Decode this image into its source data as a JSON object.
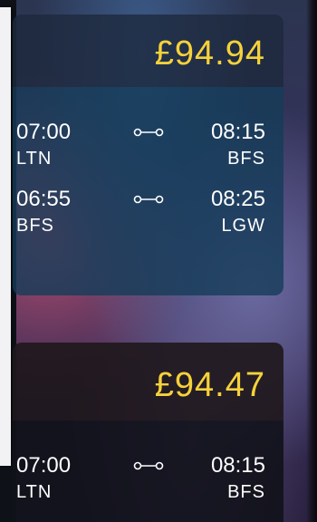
{
  "offers": [
    {
      "price": "£94.94",
      "flights": [
        {
          "dep_time": "07:00",
          "dep_code": "LTN",
          "arr_time": "08:15",
          "arr_code": "BFS"
        },
        {
          "dep_time": "06:55",
          "dep_code": "BFS",
          "arr_time": "08:25",
          "arr_code": "LGW"
        }
      ]
    },
    {
      "price": "£94.47",
      "flights": [
        {
          "dep_time": "07:00",
          "dep_code": "LTN",
          "arr_time": "08:15",
          "arr_code": "BFS"
        }
      ]
    }
  ],
  "icons": {
    "route": "route-connector-icon"
  },
  "colors": {
    "price": "#f6d23a",
    "text": "#ffffff"
  }
}
